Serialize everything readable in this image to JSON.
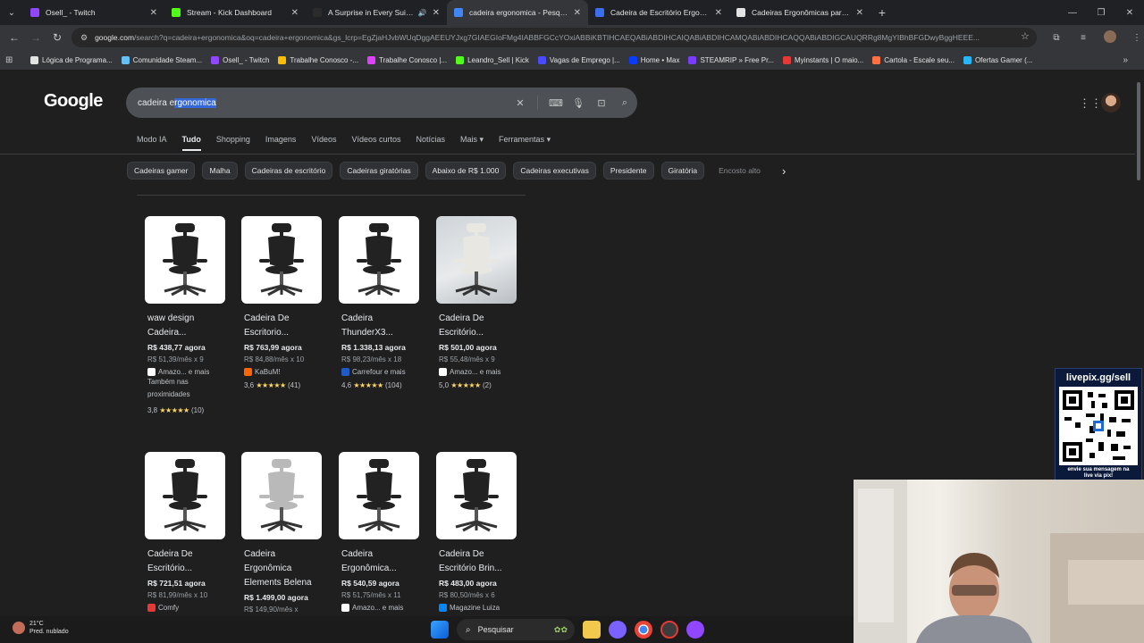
{
  "browser": {
    "tabs": [
      {
        "title": "Osell_ - Twitch",
        "color": "#9146ff",
        "active": false,
        "sound": false
      },
      {
        "title": "Stream - Kick Dashboard",
        "color": "#53fc18",
        "active": false,
        "sound": false
      },
      {
        "title": "A Surprise in Every Suitcase",
        "color": "#2b2b2b",
        "active": false,
        "sound": true
      },
      {
        "title": "cadeira ergonomica - Pesquisa",
        "color": "#4285f4",
        "active": true,
        "sound": false
      },
      {
        "title": "Cadeira de Escritório Ergonôm",
        "color": "#3a6df0",
        "active": false,
        "sound": false
      },
      {
        "title": "Cadeiras Ergonômicas para Esc",
        "color": "#e3e3e3",
        "active": false,
        "sound": false
      }
    ],
    "url_host": "google.com",
    "url_rest": "/search?q=cadeira+ergonomica&oq=cadeira+ergonomica&gs_lcrp=EgZjaHJvbWUqDggAEEUYJxg7GIAEGIoFMg4IABBFGCcYOxiABBiKBTIHCAEQABiABDIHCAIQABiABDIHCAMQABiABDIHCAQQABiABDIGCAUQRRg8MgYIBhBFGDwyBggHEEE...",
    "bookmarks": [
      {
        "label": "Lógica de Programa...",
        "color": "#e3e3e3"
      },
      {
        "label": "Comunidade Steam...",
        "color": "#66c0f4"
      },
      {
        "label": "Osell_ - Twitch",
        "color": "#9146ff"
      },
      {
        "label": "Trabalhe Conosco -...",
        "color": "#fbbc04"
      },
      {
        "label": "Trabalhe Conosco |...",
        "color": "#e040fb"
      },
      {
        "label": "Leandro_Sell | Kick",
        "color": "#53fc18"
      },
      {
        "label": "Vagas de Emprego |...",
        "color": "#4a4aff"
      },
      {
        "label": "Home • Max",
        "color": "#0a3cff"
      },
      {
        "label": "STEAMRIP » Free Pr...",
        "color": "#7a3cff"
      },
      {
        "label": "Myinstants | O maio...",
        "color": "#e53935"
      },
      {
        "label": "Cartola - Escale seu...",
        "color": "#ff7043"
      },
      {
        "label": "Ofertas Gamer (...",
        "color": "#29b6f6"
      }
    ]
  },
  "google": {
    "logo": "Google",
    "query_plain": "cadeira e",
    "query_selected": "rgonomica",
    "nav": [
      "Modo IA",
      "Tudo",
      "Shopping",
      "Imagens",
      "Vídeos",
      "Vídeos curtos",
      "Notícias",
      "Mais ▾",
      "Ferramentas ▾"
    ],
    "nav_active_index": 1,
    "chips": [
      "Cadeiras gamer",
      "Malha",
      "Cadeiras de escritório",
      "Cadeiras giratórias",
      "Abaixo de R$ 1.000",
      "Cadeiras executivas",
      "Presidente",
      "Giratória",
      "Encosto alto"
    ]
  },
  "products": [
    {
      "name1": "waw design",
      "name2": "Cadeira...",
      "price": "R$ 438,77 agora",
      "inst": "R$ 51,39/mês x 9",
      "store": "Amazo... e mais",
      "store_color": "#ffffff",
      "extra": [
        "Também nas",
        "proximidades"
      ],
      "rating": "3,8",
      "stars": "★★★★★",
      "reviews": "(10)",
      "room": false
    },
    {
      "name1": "Cadeira De",
      "name2": "Escritorio...",
      "price": "R$ 763,99 agora",
      "inst": "R$ 84,88/mês x 10",
      "store": "KaBuM!",
      "store_color": "#ff6500",
      "extra": [],
      "rating": "3,6",
      "stars": "★★★★★",
      "reviews": "(41)",
      "room": false
    },
    {
      "name1": "Cadeira",
      "name2": "ThunderX3...",
      "price": "R$ 1.338,13 agora",
      "inst": "R$ 98,23/mês x 18",
      "store": "Carrefour e mais",
      "store_color": "#1e5bc6",
      "extra": [],
      "rating": "4,6",
      "stars": "★★★★★",
      "reviews": "(104)",
      "room": false
    },
    {
      "name1": "Cadeira De",
      "name2": "Escritório...",
      "price": "R$ 501,00 agora",
      "inst": "R$ 55,48/mês x 9",
      "store": "Amazo... e mais",
      "store_color": "#ffffff",
      "extra": [],
      "rating": "5,0",
      "stars": "★★★★★",
      "reviews": "(2)",
      "room": true
    },
    {
      "name1": "Cadeira De",
      "name2": "Escritório...",
      "price": "R$ 721,51 agora",
      "inst": "R$ 81,99/mês x 10",
      "store": "Comfy",
      "store_color": "#e53935",
      "extra": [],
      "rating": "",
      "stars": "",
      "reviews": "",
      "room": false
    },
    {
      "name1": "Cadeira",
      "name2": "Ergonômica",
      "name3": "Elements Belena",
      "price": "R$ 1.499,00 agora",
      "inst": "R$ 149,90/mês x",
      "store": "",
      "store_color": "#ffffff",
      "extra": [],
      "rating": "",
      "stars": "",
      "reviews": "",
      "room": false
    },
    {
      "name1": "Cadeira",
      "name2": "Ergonômica...",
      "price": "R$ 540,59 agora",
      "inst": "R$ 51,75/mês x 11",
      "store": "Amazo... e mais",
      "store_color": "#ffffff",
      "extra": [],
      "rating": "",
      "stars": "",
      "reviews": "",
      "room": false
    },
    {
      "name1": "Cadeira De",
      "name2": "Escritório Brin...",
      "price": "R$ 483,00 agora",
      "inst": "R$ 80,50/mês x 6",
      "store": "Magazine Luiza",
      "store_color": "#0086ff",
      "extra": [],
      "rating": "",
      "stars": "",
      "reviews": "",
      "room": false
    }
  ],
  "overlay": {
    "qr_title": "livepix.gg/sell",
    "qr_msg1": "envie sua mensagem na",
    "qr_msg2": "live via pix!"
  },
  "taskbar": {
    "temp": "21°C",
    "weather": "Pred. nublado",
    "search": "Pesquisar"
  }
}
